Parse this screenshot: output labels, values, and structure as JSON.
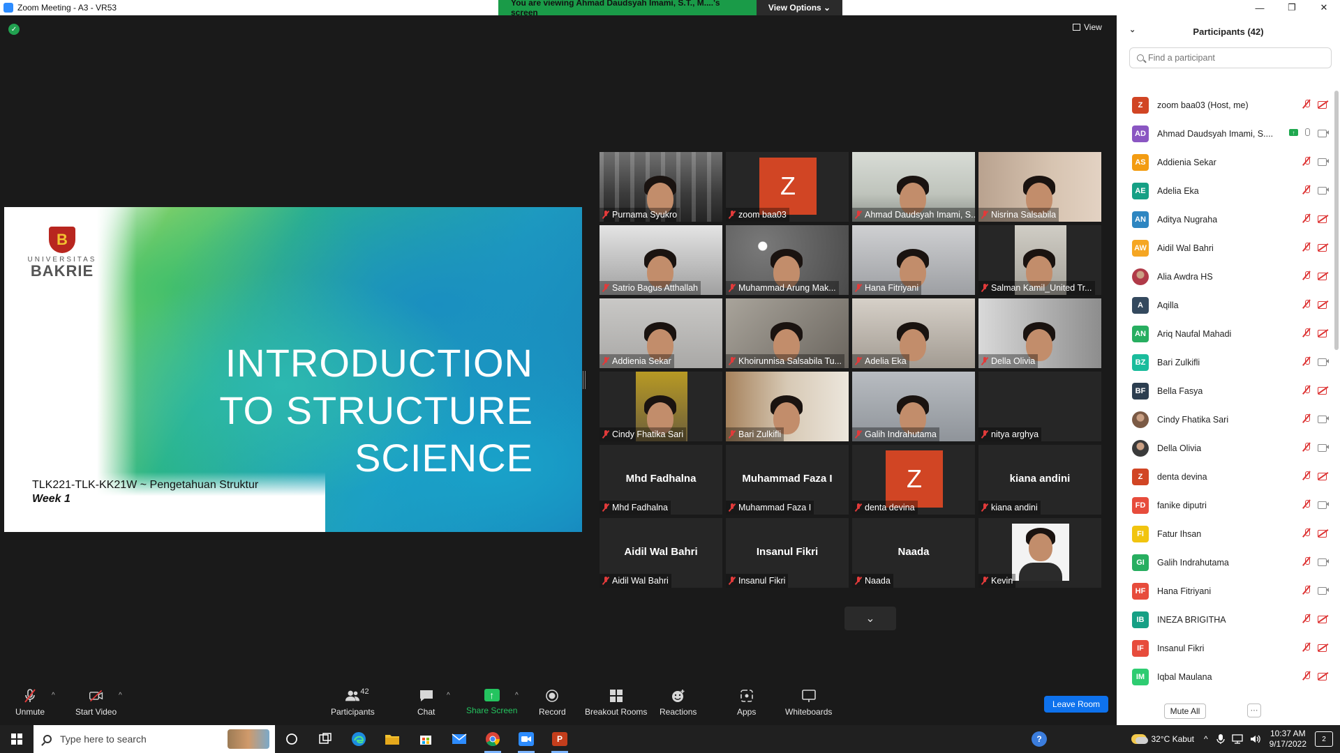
{
  "window": {
    "title": "Zoom Meeting - A3 - VR53",
    "minimize": "—",
    "restore": "❐",
    "close": "✕"
  },
  "share_banner": {
    "viewing_text": "You are viewing Ahmad Daudsyah Imami, S.T., M....'s screen",
    "view_options": "View Options ⌄"
  },
  "meeting": {
    "view_label": "View",
    "slide": {
      "logo_letter": "B",
      "logo_university": "UNIVERSITAS",
      "logo_name": "BAKRIE",
      "title_line1": "INTRODUCTION",
      "title_line2": "TO STRUCTURE",
      "title_line3": "SCIENCE",
      "course": "TLK221-TLK-KK21W ~ Pengetahuan Struktur",
      "week": "Week 1"
    },
    "gallery": [
      {
        "name": "Purnama Syukro",
        "type": "video"
      },
      {
        "name": "zoom baa03",
        "type": "avatar",
        "letter": "Z"
      },
      {
        "name": "Ahmad Daudsyah Imami, S...",
        "type": "video",
        "active": true
      },
      {
        "name": "Nisrina Salsabila",
        "type": "video"
      },
      {
        "name": "Satrio Bagus Atthallah",
        "type": "video"
      },
      {
        "name": "Muhammad Arung Mak...",
        "type": "video"
      },
      {
        "name": "Hana Fitriyani",
        "type": "video"
      },
      {
        "name": "Salman Kamil_United Tr...",
        "type": "video"
      },
      {
        "name": "Addienia Sekar",
        "type": "video"
      },
      {
        "name": "Khoirunnisa Salsabila Tu...",
        "type": "video"
      },
      {
        "name": "Adelia Eka",
        "type": "video"
      },
      {
        "name": "Della Olivia",
        "type": "video"
      },
      {
        "name": "Cindy Fhatika Sari",
        "type": "video"
      },
      {
        "name": "Bari Zulkifli",
        "type": "video"
      },
      {
        "name": "Galih Indrahutama",
        "type": "video"
      },
      {
        "name": "nitya arghya",
        "type": "blank"
      },
      {
        "name": "Mhd Fadhalna",
        "type": "text",
        "big": "Mhd Fadhalna"
      },
      {
        "name": "Muhammad Faza I",
        "type": "text",
        "big": "Muhammad Faza I"
      },
      {
        "name": "denta devina",
        "type": "avatar",
        "letter": "Z"
      },
      {
        "name": "kiana andini",
        "type": "text",
        "big": "kiana andini"
      },
      {
        "name": "Aidil Wal Bahri",
        "type": "text",
        "big": "Aidil Wal Bahri"
      },
      {
        "name": "Insanul Fikri",
        "type": "text",
        "big": "Insanul Fikri"
      },
      {
        "name": "Naada",
        "type": "text",
        "big": "Naada"
      },
      {
        "name": "Kevin",
        "type": "photo"
      }
    ],
    "more_arrow": "⌄"
  },
  "toolbar": {
    "unmute": "Unmute",
    "start_video": "Start Video",
    "participants": "Participants",
    "participants_count": "42",
    "chat": "Chat",
    "share_screen": "Share Screen",
    "record": "Record",
    "breakout_rooms": "Breakout Rooms",
    "reactions": "Reactions",
    "apps": "Apps",
    "whiteboards": "Whiteboards",
    "leave": "Leave Room",
    "caret": "^"
  },
  "participants_panel": {
    "title": "Participants (42)",
    "collapse": "⌄",
    "search_placeholder": "Find a participant",
    "mute_all": "Mute All",
    "more": "···",
    "list": [
      {
        "initials": "Z",
        "name": "zoom baa03 (Host, me)",
        "color": "#d14524",
        "mic": "off",
        "cam": "off"
      },
      {
        "initials": "AD",
        "name": "Ahmad Daudsyah Imami, S....",
        "color": "#8a56c2",
        "mic": "on",
        "cam": "on",
        "sharing": true
      },
      {
        "initials": "AS",
        "name": "Addienia Sekar",
        "color": "#f39c12",
        "mic": "off",
        "cam": "on"
      },
      {
        "initials": "AE",
        "name": "Adelia Eka",
        "color": "#16a085",
        "mic": "off",
        "cam": "on"
      },
      {
        "initials": "AN",
        "name": "Aditya Nugraha",
        "color": "#2e86c1",
        "mic": "off",
        "cam": "off"
      },
      {
        "initials": "AW",
        "name": "Aidil Wal Bahri",
        "color": "#f5a623",
        "mic": "off",
        "cam": "off"
      },
      {
        "initials": "",
        "name": "Alia Awdra HS",
        "color": "#b03a48",
        "mic": "off",
        "cam": "off",
        "photo": true
      },
      {
        "initials": "A",
        "name": "Aqilla",
        "color": "#34495e",
        "mic": "off",
        "cam": "off"
      },
      {
        "initials": "AN",
        "name": "Ariq Naufal Mahadi",
        "color": "#27ae60",
        "mic": "off",
        "cam": "off"
      },
      {
        "initials": "BZ",
        "name": "Bari Zulkifli",
        "color": "#1abc9c",
        "mic": "off",
        "cam": "on"
      },
      {
        "initials": "BF",
        "name": "Bella Fasya",
        "color": "#2c3e50",
        "mic": "off",
        "cam": "off"
      },
      {
        "initials": "",
        "name": "Cindy Fhatika Sari",
        "color": "#7b5a45",
        "mic": "off",
        "cam": "on",
        "photo": true
      },
      {
        "initials": "",
        "name": "Della Olivia",
        "color": "#3a3a3a",
        "mic": "off",
        "cam": "on",
        "photo": true
      },
      {
        "initials": "Z",
        "name": "denta devina",
        "color": "#d14524",
        "mic": "off",
        "cam": "off"
      },
      {
        "initials": "FD",
        "name": "fanike diputri",
        "color": "#e74c3c",
        "mic": "off",
        "cam": "on"
      },
      {
        "initials": "FI",
        "name": "Fatur Ihsan",
        "color": "#f1c40f",
        "mic": "off",
        "cam": "off"
      },
      {
        "initials": "GI",
        "name": "Galih Indrahutama",
        "color": "#27ae60",
        "mic": "off",
        "cam": "on"
      },
      {
        "initials": "HF",
        "name": "Hana Fitriyani",
        "color": "#e74c3c",
        "mic": "off",
        "cam": "on"
      },
      {
        "initials": "IB",
        "name": "INEZA BRIGITHA",
        "color": "#16a085",
        "mic": "off",
        "cam": "off"
      },
      {
        "initials": "IF",
        "name": "Insanul Fikri",
        "color": "#e74c3c",
        "mic": "off",
        "cam": "off"
      },
      {
        "initials": "IM",
        "name": "Iqbal Maulana",
        "color": "#2ecc71",
        "mic": "off",
        "cam": "off"
      }
    ]
  },
  "taskbar": {
    "search_placeholder": "Type here to search",
    "weather": "32°C  Kabut",
    "time": "10:37 AM",
    "date": "9/17/2022",
    "notifications": "2",
    "tray_chevron": "^"
  }
}
